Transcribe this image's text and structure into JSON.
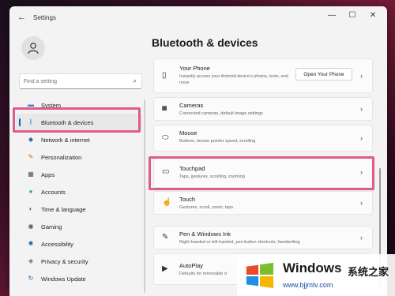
{
  "window": {
    "title": "Settings",
    "back_glyph": "←",
    "min_glyph": "—",
    "max_glyph": "☐",
    "close_glyph": "✕"
  },
  "search": {
    "placeholder": "Find a setting",
    "icon": "search-icon"
  },
  "nav": {
    "items": [
      {
        "label": "System",
        "icon": "monitor-icon",
        "glyph": "▬",
        "color": "#3a7bd5"
      },
      {
        "label": "Bluetooth & devices",
        "icon": "bluetooth-icon",
        "glyph": "ᛒ",
        "color": "#0067c0",
        "selected": true
      },
      {
        "label": "Network & internet",
        "icon": "wifi-icon",
        "glyph": "◆",
        "color": "#2b6cb0"
      },
      {
        "label": "Personalization",
        "icon": "brush-icon",
        "glyph": "✎",
        "color": "#c96a1c"
      },
      {
        "label": "Apps",
        "icon": "apps-icon",
        "glyph": "▦",
        "color": "#555555"
      },
      {
        "label": "Accounts",
        "icon": "person-icon",
        "glyph": "●",
        "color": "#2aa876"
      },
      {
        "label": "Time & language",
        "icon": "globe-clock-icon",
        "glyph": "◐",
        "color": "#2b6cb0"
      },
      {
        "label": "Gaming",
        "icon": "gamepad-icon",
        "glyph": "◉",
        "color": "#555555"
      },
      {
        "label": "Accessibility",
        "icon": "accessibility-icon",
        "glyph": "✱",
        "color": "#1c5fa8"
      },
      {
        "label": "Privacy & security",
        "icon": "shield-icon",
        "glyph": "◈",
        "color": "#666666"
      },
      {
        "label": "Windows Update",
        "icon": "update-icon",
        "glyph": "↻",
        "color": "#1c5fa8"
      }
    ]
  },
  "main": {
    "title": "Bluetooth & devices",
    "cards": [
      {
        "title": "Your Phone",
        "sub": "Instantly access your Android device's photos, texts, and more",
        "icon": "phone-icon",
        "glyph": "▯",
        "button": "Open Your Phone"
      },
      {
        "title": "Cameras",
        "sub": "Connected cameras, default image settings",
        "icon": "camera-icon",
        "glyph": "◙"
      },
      {
        "title": "Mouse",
        "sub": "Buttons, mouse pointer speed, scrolling",
        "icon": "mouse-icon",
        "glyph": "⬭"
      },
      {
        "title": "Touchpad",
        "sub": "Taps, gestures, scrolling, zooming",
        "icon": "touchpad-icon",
        "glyph": "▭"
      },
      {
        "title": "Touch",
        "sub": "Gestures, scroll, zoom, taps",
        "icon": "touch-icon",
        "glyph": "☝"
      },
      {
        "title": "Pen & Windows Ink",
        "sub": "Right-handed or left-handed, pen button shortcuts, handwriting",
        "icon": "pen-icon",
        "glyph": "✎"
      },
      {
        "title": "AutoPlay",
        "sub": "Defaults for removable d",
        "icon": "autoplay-icon",
        "glyph": "▶"
      }
    ],
    "chevron": "›"
  },
  "watermark": {
    "brand": "Windows",
    "cn": "系统之家",
    "url": "www.bjjmlv.com"
  },
  "colors": {
    "accent": "#0067c0",
    "highlight": "#e05a8d"
  }
}
